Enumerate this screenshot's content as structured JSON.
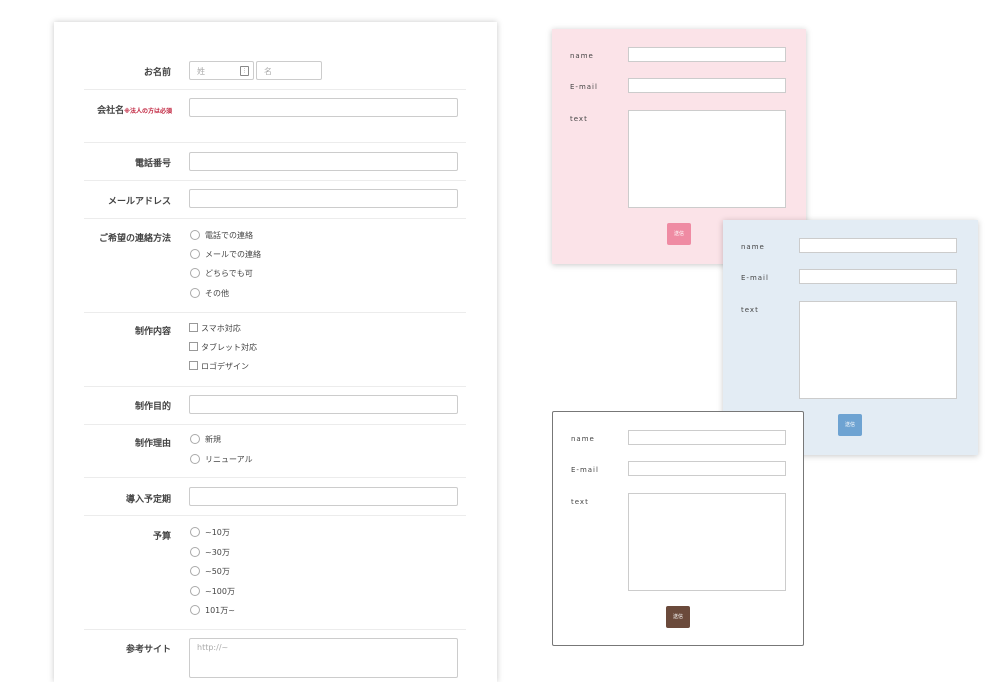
{
  "main_form": {
    "name": {
      "label": "お名前",
      "last_placeholder": "姓",
      "first_placeholder": "名"
    },
    "company": {
      "label": "会社名",
      "required_note": "※法人の方は必須"
    },
    "phone": {
      "label": "電話番号"
    },
    "email": {
      "label": "メールアドレス"
    },
    "contact_method": {
      "label": "ご希望の連絡方法",
      "options": [
        "電話での連絡",
        "メールでの連絡",
        "どちらでも可",
        "その他"
      ]
    },
    "production": {
      "label": "制作内容",
      "options": [
        "スマホ対応",
        "タブレット対応",
        "ロゴデザイン"
      ]
    },
    "purpose": {
      "label": "制作目的"
    },
    "reason": {
      "label": "制作理由",
      "options": [
        "新規",
        "リニューアル"
      ]
    },
    "schedule": {
      "label": "導入予定期"
    },
    "budget": {
      "label": "予算",
      "options": [
        "~10万",
        "~30万",
        "~50万",
        "~100万",
        "101万~"
      ]
    },
    "reference": {
      "label": "参考サイト",
      "placeholder": "http://~"
    }
  },
  "cards": [
    {
      "name_label": "name",
      "email_label": "E-mail",
      "text_label": "text",
      "submit_label": "送信",
      "bg_color": "#fbe3e8",
      "button_color": "#ef8ba3"
    },
    {
      "name_label": "name",
      "email_label": "E-mail",
      "text_label": "text",
      "submit_label": "送信",
      "bg_color": "#e3ecf4",
      "button_color": "#6ea3d2"
    },
    {
      "name_label": "name",
      "email_label": "E-mail",
      "text_label": "text",
      "submit_label": "送信",
      "bg_color": "#ffffff",
      "button_color": "#6b4a3b"
    }
  ]
}
